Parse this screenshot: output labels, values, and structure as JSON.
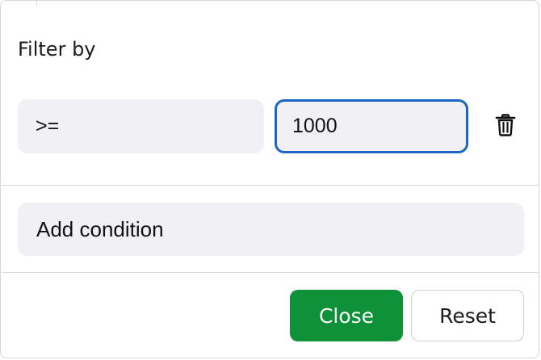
{
  "filter": {
    "title": "Filter by",
    "operator": ">=",
    "value": "1000",
    "delete_icon": "trash-icon"
  },
  "actions": {
    "add_condition_label": "Add condition",
    "close_label": "Close",
    "reset_label": "Reset"
  },
  "colors": {
    "accent_border": "#1a66c4",
    "primary_button": "#0e9138",
    "field_background": "#f0f0f5"
  }
}
